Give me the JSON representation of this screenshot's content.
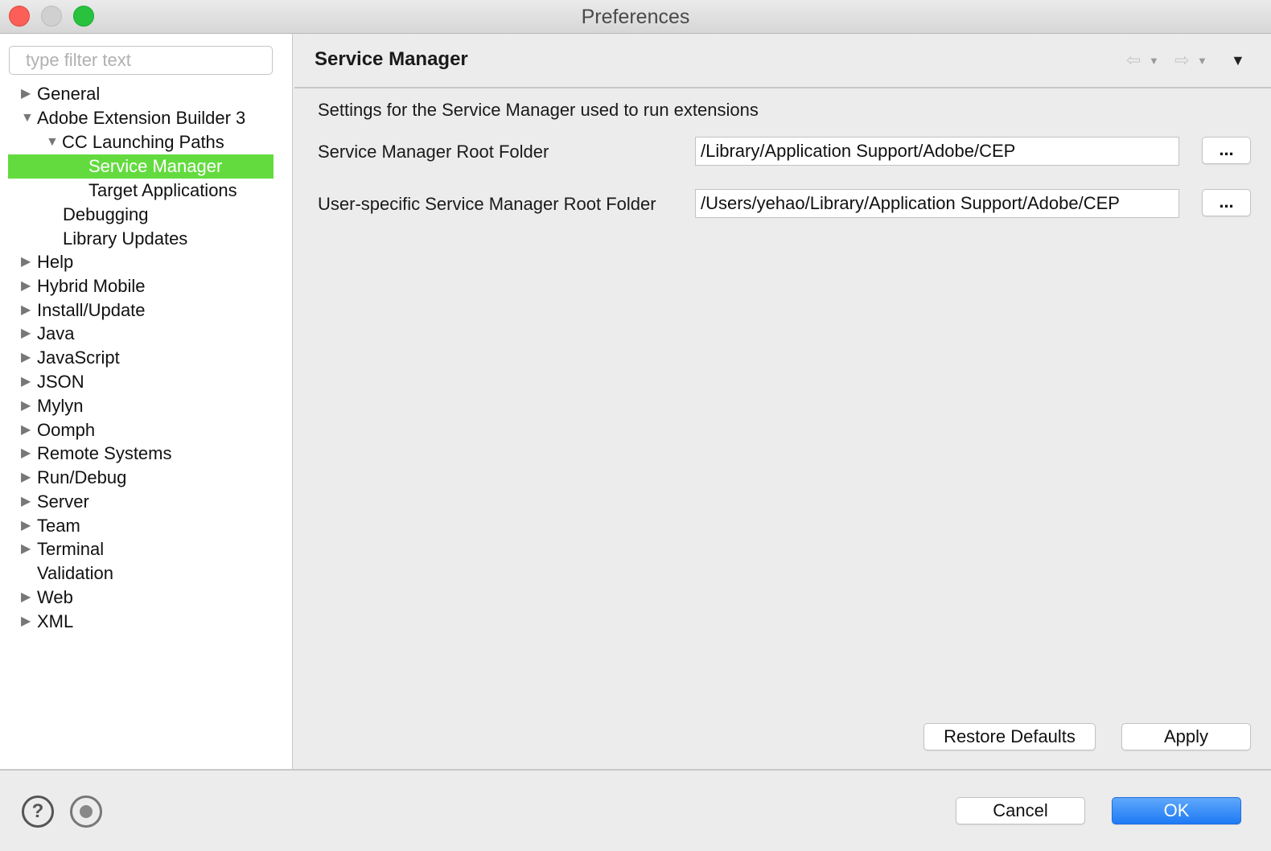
{
  "window": {
    "title": "Preferences"
  },
  "filter": {
    "placeholder": "type filter text"
  },
  "tree": [
    {
      "label": "General",
      "twisty": "collapsed",
      "selected": false
    },
    {
      "label": "Adobe Extension Builder 3",
      "twisty": "expanded",
      "selected": false
    },
    {
      "label": "CC Launching Paths",
      "twisty": "expanded",
      "selected": false
    },
    {
      "label": "Service Manager",
      "twisty": "none",
      "selected": true
    },
    {
      "label": "Target Applications",
      "twisty": "none",
      "selected": false
    },
    {
      "label": "Debugging",
      "twisty": "none",
      "selected": false
    },
    {
      "label": "Library Updates",
      "twisty": "none",
      "selected": false
    },
    {
      "label": "Help",
      "twisty": "collapsed",
      "selected": false
    },
    {
      "label": "Hybrid Mobile",
      "twisty": "collapsed",
      "selected": false
    },
    {
      "label": "Install/Update",
      "twisty": "collapsed",
      "selected": false
    },
    {
      "label": "Java",
      "twisty": "collapsed",
      "selected": false
    },
    {
      "label": "JavaScript",
      "twisty": "collapsed",
      "selected": false
    },
    {
      "label": "JSON",
      "twisty": "collapsed",
      "selected": false
    },
    {
      "label": "Mylyn",
      "twisty": "collapsed",
      "selected": false
    },
    {
      "label": "Oomph",
      "twisty": "collapsed",
      "selected": false
    },
    {
      "label": "Remote Systems",
      "twisty": "collapsed",
      "selected": false
    },
    {
      "label": "Run/Debug",
      "twisty": "collapsed",
      "selected": false
    },
    {
      "label": "Server",
      "twisty": "collapsed",
      "selected": false
    },
    {
      "label": "Team",
      "twisty": "collapsed",
      "selected": false
    },
    {
      "label": "Terminal",
      "twisty": "collapsed",
      "selected": false
    },
    {
      "label": "Validation",
      "twisty": "none",
      "selected": false
    },
    {
      "label": "Web",
      "twisty": "collapsed",
      "selected": false
    },
    {
      "label": "XML",
      "twisty": "collapsed",
      "selected": false
    }
  ],
  "page": {
    "title": "Service Manager",
    "description": "Settings for the Service Manager used to run extensions",
    "fields": [
      {
        "label": "Service Manager Root Folder",
        "value": "/Library/Application Support/Adobe/CEP",
        "browse_label": "..."
      },
      {
        "label": "User-specific Service Manager Root Folder",
        "value": "/Users/yehao/Library/Application Support/Adobe/CEP",
        "browse_label": "..."
      }
    ],
    "restore_defaults_label": "Restore Defaults",
    "apply_label": "Apply"
  },
  "icons": {
    "back": "back-arrow-icon",
    "forward": "forward-arrow-icon",
    "menu": "view-menu-icon",
    "help": "help-icon",
    "record": "import-export-icon"
  },
  "footer": {
    "help_glyph": "?",
    "cancel_label": "Cancel",
    "ok_label": "OK"
  },
  "colors": {
    "selection": "#63db3f",
    "ok_button": "#1f7af4"
  }
}
